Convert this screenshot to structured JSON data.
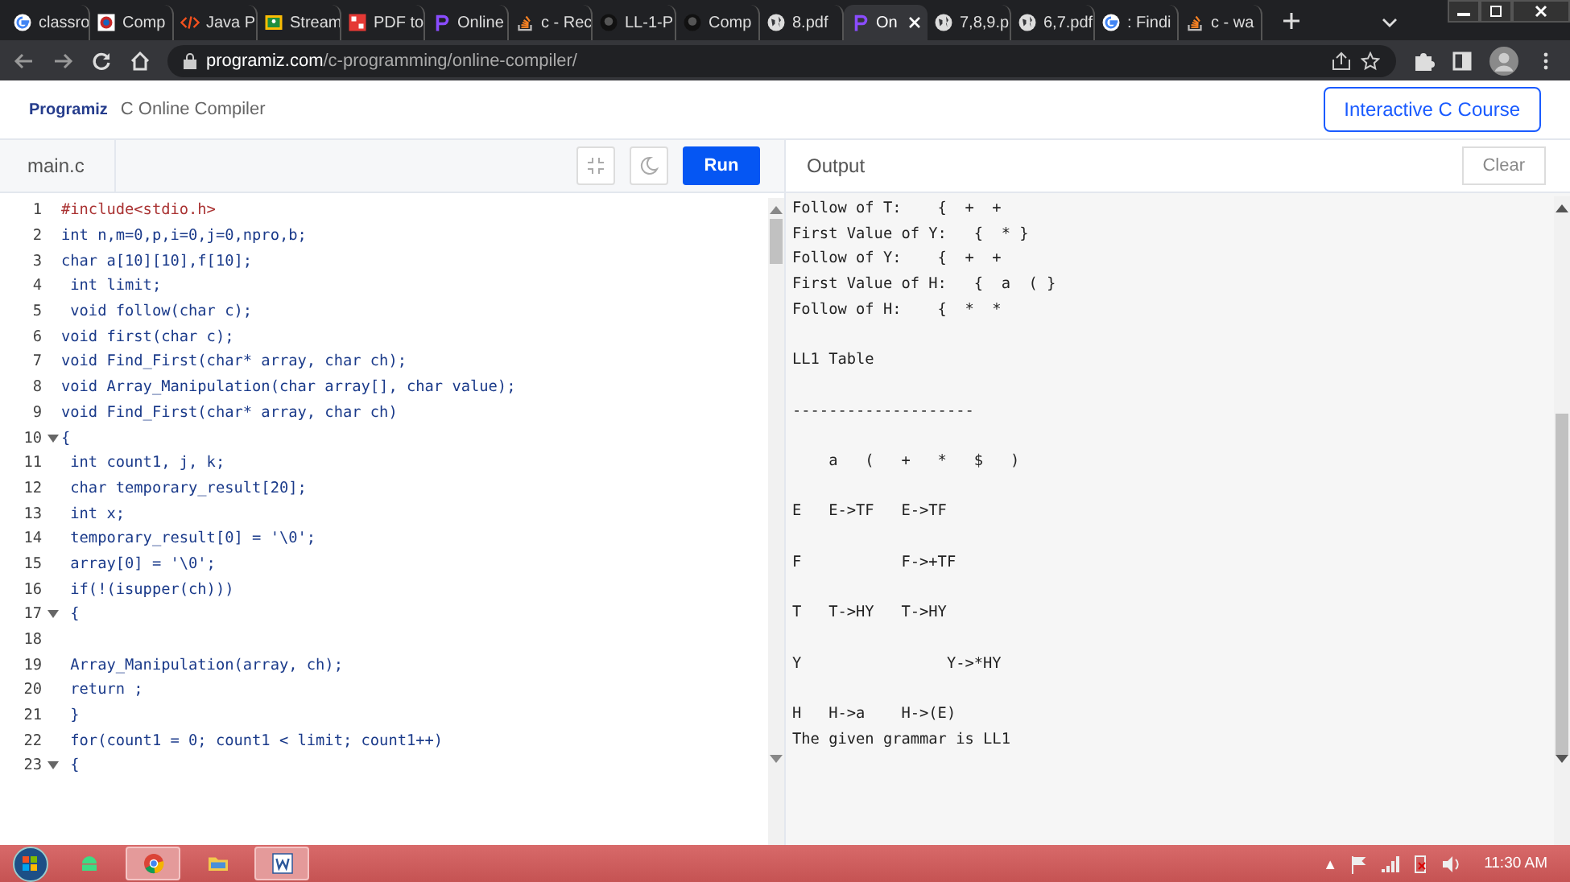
{
  "browser": {
    "tabs": [
      {
        "title": "classro",
        "kind": "google",
        "selected": false
      },
      {
        "title": "Comp",
        "kind": "badge",
        "selected": false
      },
      {
        "title": "Java P",
        "kind": "code",
        "selected": false
      },
      {
        "title": "Stream",
        "kind": "classroom",
        "selected": false
      },
      {
        "title": "PDF to",
        "kind": "pdf",
        "selected": false
      },
      {
        "title": "Online",
        "kind": "programiz",
        "selected": false
      },
      {
        "title": "c - Rec",
        "kind": "stack",
        "selected": false
      },
      {
        "title": "LL-1-P",
        "kind": "github",
        "selected": false
      },
      {
        "title": "Comp",
        "kind": "github",
        "selected": false
      },
      {
        "title": "8.pdf",
        "kind": "globe",
        "selected": false
      },
      {
        "title": "On",
        "kind": "programiz",
        "selected": true
      },
      {
        "title": "7,8,9.p",
        "kind": "globe",
        "selected": false
      },
      {
        "title": "6,7.pdf",
        "kind": "globe",
        "selected": false
      },
      {
        "title": ": Findi",
        "kind": "google",
        "selected": false
      },
      {
        "title": "c - wa",
        "kind": "stack",
        "selected": false
      }
    ],
    "url_host": "programiz.com",
    "url_path": "/c-programming/online-compiler/"
  },
  "header": {
    "logo": "Programiz",
    "title": "C Online Compiler",
    "course_button": "Interactive C Course"
  },
  "editor": {
    "file_tab": "main.c",
    "run_button": "Run",
    "lines": [
      {
        "number": "1",
        "code": "#include<stdio.h>",
        "kind": "include"
      },
      {
        "number": "2",
        "code": "int n,m=0,p,i=0,j=0,npro,b;"
      },
      {
        "number": "3",
        "code": "char a[10][10],f[10];"
      },
      {
        "number": "4",
        "code": " int limit;"
      },
      {
        "number": "5",
        "code": " void follow(char c);"
      },
      {
        "number": "6",
        "code": "void first(char c);"
      },
      {
        "number": "7",
        "code": "void Find_First(char* array, char ch);"
      },
      {
        "number": "8",
        "code": "void Array_Manipulation(char array[], char value);"
      },
      {
        "number": "9",
        "code": "void Find_First(char* array, char ch)"
      },
      {
        "number": "10",
        "code": "{",
        "fold": true
      },
      {
        "number": "11",
        "code": " int count1, j, k;"
      },
      {
        "number": "12",
        "code": " char temporary_result[20];"
      },
      {
        "number": "13",
        "code": " int x;"
      },
      {
        "number": "14",
        "code": " temporary_result[0] = '\\0';"
      },
      {
        "number": "15",
        "code": " array[0] = '\\0';"
      },
      {
        "number": "16",
        "code": " if(!(isupper(ch)))"
      },
      {
        "number": "17",
        "code": " {",
        "fold": true
      },
      {
        "number": "18"
      },
      {
        "number": "19",
        "code": " Array_Manipulation(array, ch);"
      },
      {
        "number": "20",
        "code": " return ;"
      },
      {
        "number": "21",
        "code": " }"
      },
      {
        "number": "22",
        "code": " for(count1 = 0; count1 < limit; count1++)"
      },
      {
        "number": "23",
        "code": " {",
        "fold": true
      }
    ]
  },
  "output": {
    "title": "Output",
    "clear_button": "Clear",
    "text": "Follow of T:    {  +  +\nFirst Value of Y:   {  * }\nFollow of Y:    {  +  +\nFirst Value of H:   {  a  ( }\nFollow of H:    {  *  *\n\nLL1 Table\n\n--------------------\n\n    a   (   +   *   $   )\n\nE   E->TF   E->TF\n\nF           F->+TF\n\nT   T->HY   T->HY\n\nY                Y->*HY\n\nH   H->a    H->(E)\nThe given grammar is LL1"
  },
  "taskbar": {
    "apps": [
      {
        "kind": "android",
        "selected": false
      },
      {
        "kind": "chrome",
        "selected": true
      },
      {
        "kind": "folder",
        "selected": false
      },
      {
        "kind": "word",
        "selected": true
      }
    ],
    "tray_arrow": "▲",
    "clock": "11:30 AM"
  }
}
